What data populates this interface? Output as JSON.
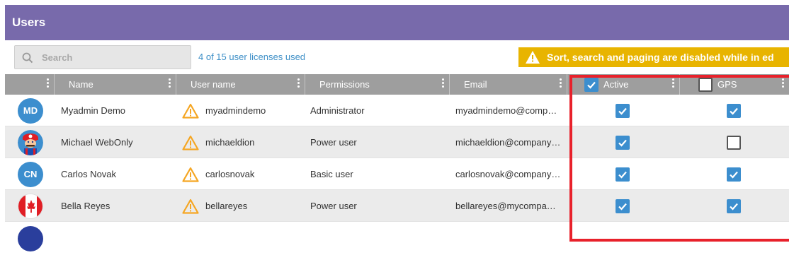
{
  "header": {
    "title": "Users"
  },
  "search": {
    "placeholder": "Search"
  },
  "licenses_text": "4 of 15 user licenses used",
  "banner_text": "Sort, search and paging are disabled while in ed",
  "columns": {
    "name": "Name",
    "username": "User name",
    "permissions": "Permissions",
    "email": "Email",
    "active": "Active",
    "gps": "GPS"
  },
  "header_checks": {
    "active": true,
    "gps": false
  },
  "rows": [
    {
      "initials": "MD",
      "avatar": "initials",
      "name": "Myadmin Demo",
      "username": "myadmindemo",
      "permission": "Administrator",
      "email": "myadmindemo@comp…",
      "active": true,
      "gps": true
    },
    {
      "initials": "",
      "avatar": "mario-image",
      "name": "Michael WebOnly",
      "username": "michaeldion",
      "permission": "Power user",
      "email": "michaeldion@company…",
      "active": true,
      "gps": false
    },
    {
      "initials": "CN",
      "avatar": "initials",
      "name": "Carlos Novak",
      "username": "carlosnovak",
      "permission": "Basic user",
      "email": "carlosnovak@company…",
      "active": true,
      "gps": true
    },
    {
      "initials": "",
      "avatar": "canada-flag",
      "name": "Bella Reyes",
      "username": "bellareyes",
      "permission": "Power user",
      "email": "bellareyes@mycompa…",
      "active": true,
      "gps": true
    }
  ],
  "colors": {
    "header": "#786aab",
    "accent": "#3c8ece",
    "banner": "#e8b400",
    "warning": "#f5a623",
    "highlight": "#e8212b"
  }
}
